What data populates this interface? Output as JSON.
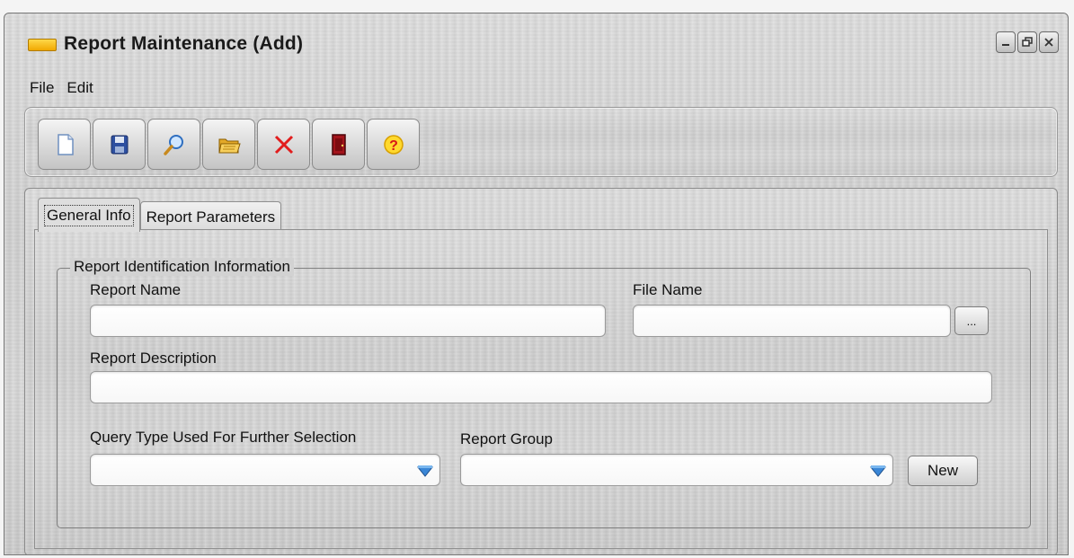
{
  "window": {
    "title": "Report Maintenance (Add)"
  },
  "menu": {
    "items": [
      "File",
      "Edit"
    ]
  },
  "toolbar": {
    "buttons": [
      "new-document",
      "save",
      "search",
      "open-folder",
      "delete",
      "exit",
      "help"
    ]
  },
  "tabs": [
    "General Info",
    "Report Parameters"
  ],
  "form": {
    "group_title": "Report Identification Information",
    "report_name_label": "Report Name",
    "report_name_value": "",
    "file_name_label": "File Name",
    "file_name_value": "",
    "browse_label": "...",
    "report_description_label": "Report Description",
    "report_description_value": "",
    "query_type_label": "Query Type Used For Further Selection",
    "query_type_value": "",
    "report_group_label": "Report Group",
    "report_group_value": "",
    "new_button_label": "New"
  }
}
